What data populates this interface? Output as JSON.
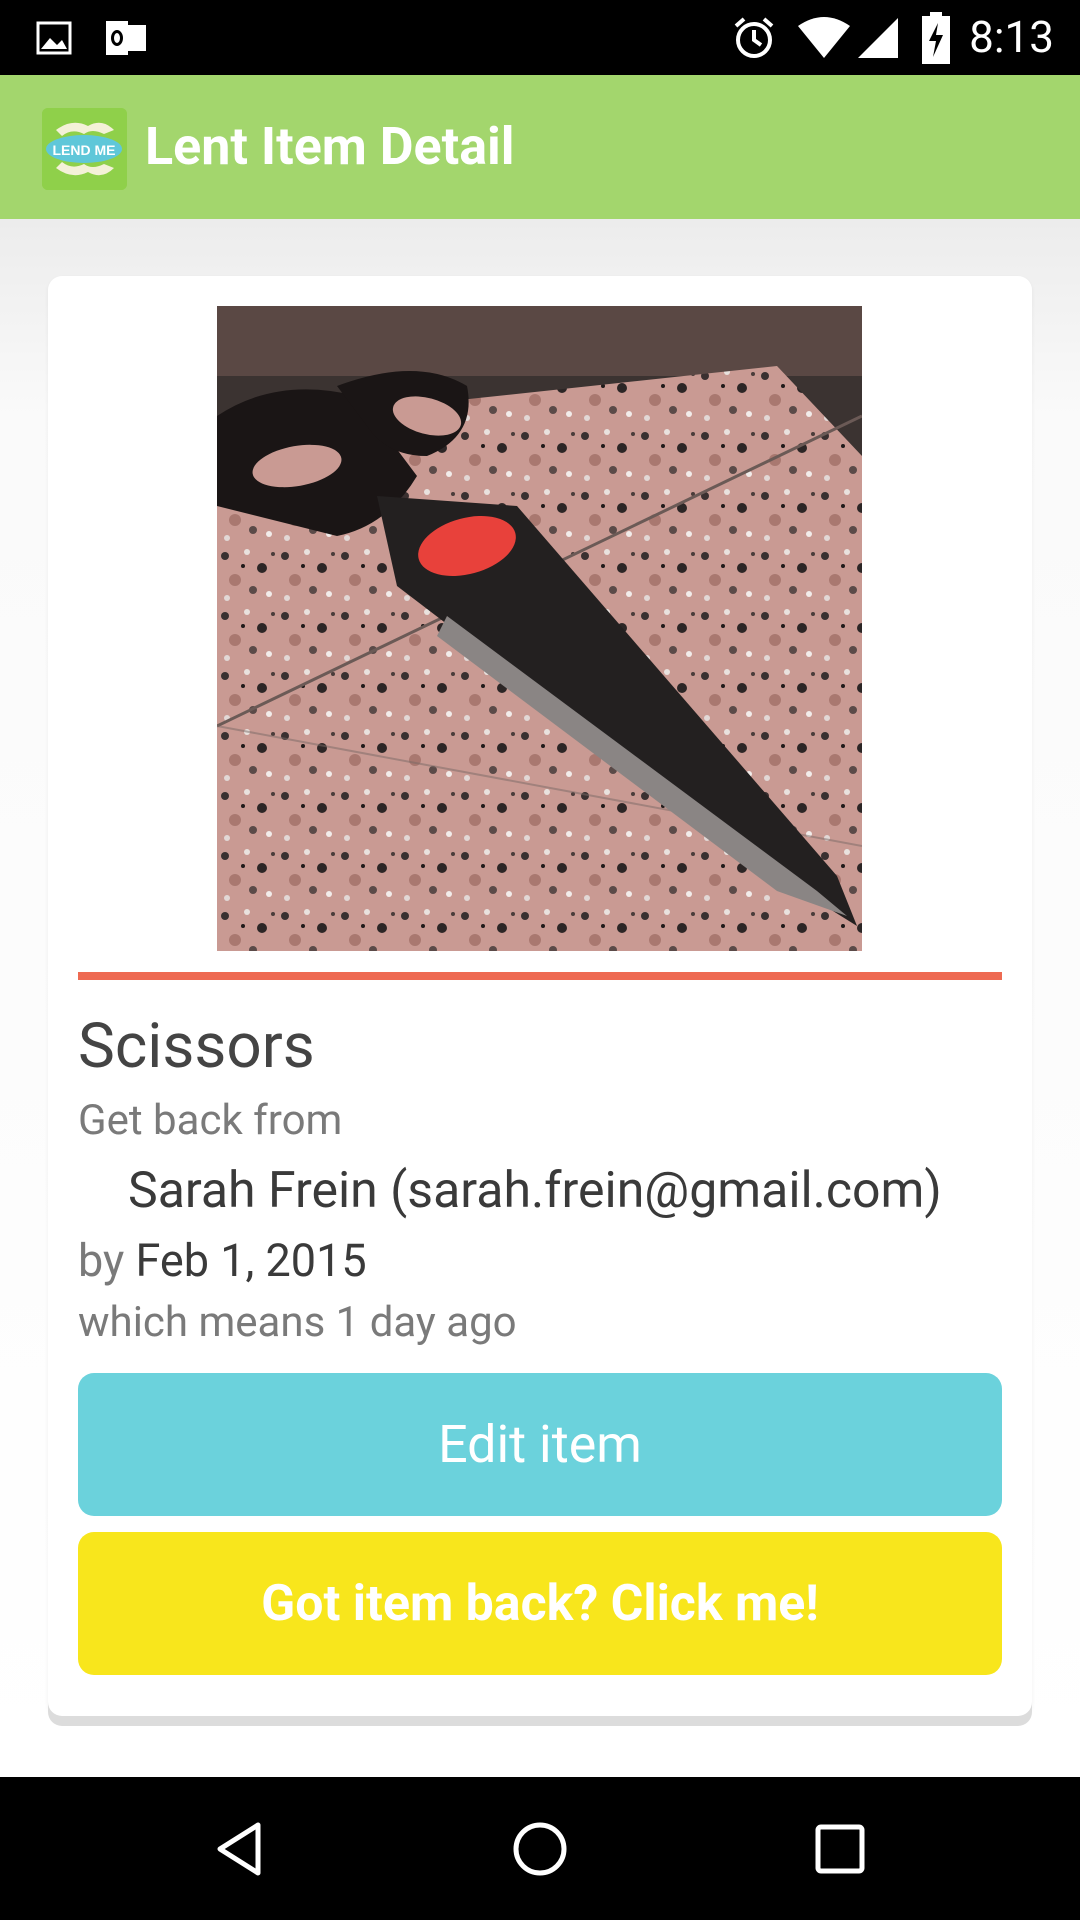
{
  "status_bar": {
    "time": "8:13",
    "left_icons": [
      "image-icon",
      "outlook-icon"
    ],
    "right_icons": [
      "alarm-icon",
      "wifi-icon",
      "cell-signal-icon",
      "battery-charging-icon"
    ]
  },
  "app_bar": {
    "logo_text": "LEND ME",
    "title": "Lent Item Detail"
  },
  "item": {
    "photo_alt": "photo of scissors on granite countertop",
    "name": "Scissors",
    "get_back_label": "Get back from",
    "borrower": "Sarah Frein (sarah.frein@gmail.com)",
    "by_label": "by",
    "due_date": "Feb 1, 2015",
    "relative_text": "which means 1 day ago"
  },
  "buttons": {
    "edit_label": "Edit item",
    "returned_label": "Got item back? Click me!"
  },
  "colors": {
    "app_bar": "#a3d66d",
    "divider": "#ee6a52",
    "edit_button": "#6bd2dc",
    "returned_button": "#f8e61c"
  },
  "nav_bar": {
    "buttons": [
      "back-icon",
      "home-icon",
      "recents-icon"
    ]
  }
}
